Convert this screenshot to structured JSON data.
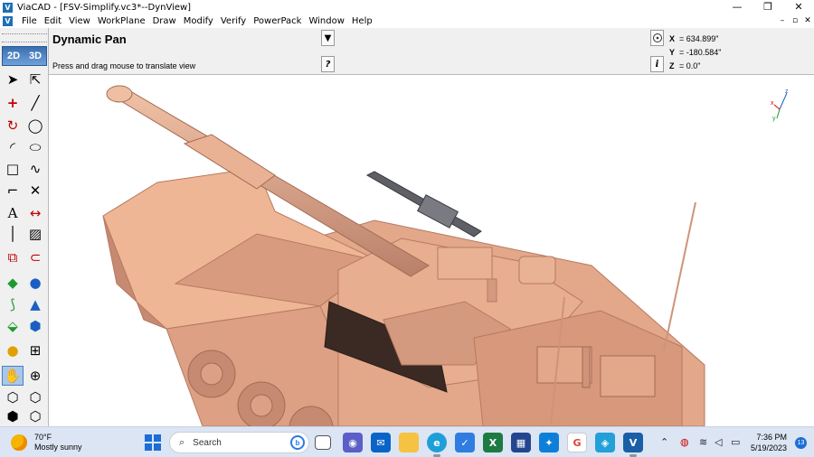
{
  "window": {
    "app_icon": "V",
    "title": "ViaCAD - [FSV-Simplify.vc3*--DynView]",
    "controls": {
      "minimize": "—",
      "maximize": "❐",
      "close": "✕"
    },
    "doc_controls": {
      "minimize": "–",
      "restore": "▫",
      "close": "✕"
    }
  },
  "menu": [
    "File",
    "Edit",
    "View",
    "WorkPlane",
    "Draw",
    "Modify",
    "Verify",
    "PowerPack",
    "Window",
    "Help"
  ],
  "tool_info": {
    "name": "Dynamic Pan",
    "hint": "Press and drag mouse to translate view",
    "dropdown_icon": "▼",
    "help_icon": "?",
    "info_icon": "i",
    "target_icon": "target-icon"
  },
  "coordinates": {
    "x_label": "X",
    "x_value": "= 634.899\"",
    "y_label": "Y",
    "y_value": "= -180.584\"",
    "z_label": "Z",
    "z_value": "= 0.0\""
  },
  "toolbar": {
    "mode_2d": "2D",
    "mode_3d": "3D",
    "active_tool": "dynamic-pan"
  },
  "axis_triad": {
    "x": "x",
    "y": "y",
    "z": "z"
  },
  "colors": {
    "model": "#e3a78a",
    "model_dark": "#b97c62",
    "accent": "#1b6ed6",
    "taskbar": "#dce5f3"
  },
  "taskbar": {
    "weather_temp": "70°F",
    "weather_desc": "Mostly sunny",
    "search_placeholder": "Search",
    "time": "7:36 PM",
    "date": "5/19/2023",
    "notification_count": "13",
    "apps": [
      "task-view",
      "meet",
      "mail",
      "file-explorer",
      "edge",
      "todo",
      "excel",
      "store",
      "app-blue",
      "chrome",
      "photos",
      "viacad"
    ]
  }
}
